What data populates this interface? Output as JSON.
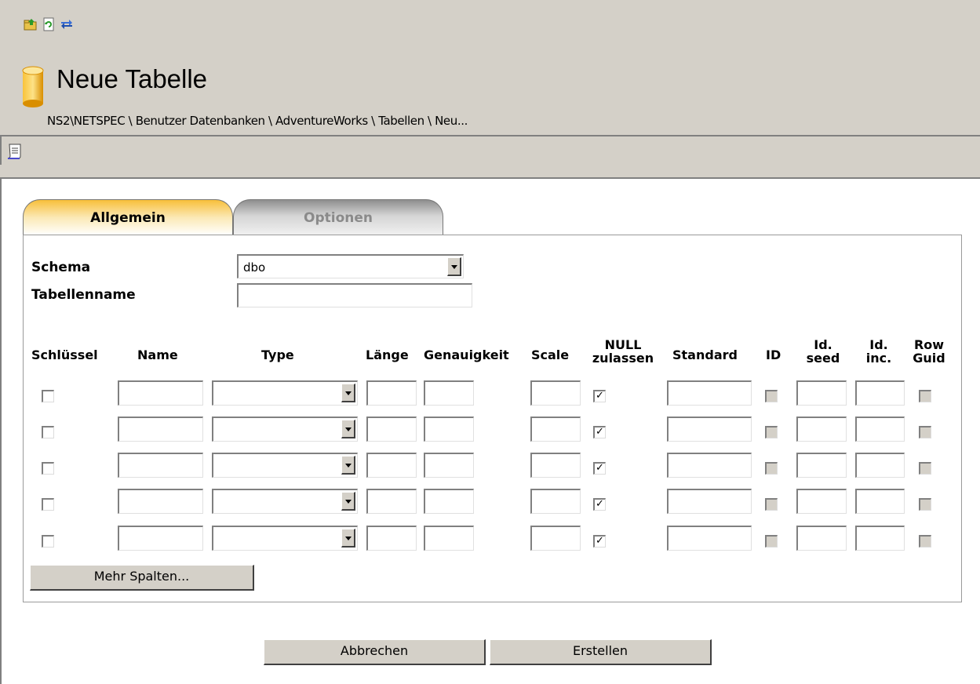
{
  "title": "Neue Tabelle",
  "breadcrumb": "NS2\\NETSPEC \\ Benutzer Datenbanken \\ AdventureWorks \\ Tabellen \\ Neu...",
  "toolbar_icons": [
    "folder-up-icon",
    "refresh-icon",
    "sync-icon"
  ],
  "action_icons": [
    "script-icon"
  ],
  "tabs": [
    {
      "label": "Allgemein",
      "active": true
    },
    {
      "label": "Optionen",
      "active": false
    }
  ],
  "form": {
    "schema_label": "Schema",
    "schema_value": "dbo",
    "tablename_label": "Tabellenname",
    "tablename_value": ""
  },
  "columns_header": {
    "key": "Schlüssel",
    "name": "Name",
    "type": "Type",
    "length": "Länge",
    "precision": "Genauigkeit",
    "scale": "Scale",
    "nullable_1": "NULL",
    "nullable_2": "zulassen",
    "default": "Standard",
    "id": "ID",
    "seed_1": "Id.",
    "seed_2": "seed",
    "inc_1": "Id.",
    "inc_2": "inc.",
    "rowguid_1": "Row",
    "rowguid_2": "Guid"
  },
  "rows": [
    {
      "key": false,
      "name": "",
      "type": "",
      "length": "",
      "precision": "",
      "scale": "",
      "nullable": true,
      "default": "",
      "id": false,
      "seed": "",
      "inc": "",
      "rowguid": false
    },
    {
      "key": false,
      "name": "",
      "type": "",
      "length": "",
      "precision": "",
      "scale": "",
      "nullable": true,
      "default": "",
      "id": false,
      "seed": "",
      "inc": "",
      "rowguid": false
    },
    {
      "key": false,
      "name": "",
      "type": "",
      "length": "",
      "precision": "",
      "scale": "",
      "nullable": true,
      "default": "",
      "id": false,
      "seed": "",
      "inc": "",
      "rowguid": false
    },
    {
      "key": false,
      "name": "",
      "type": "",
      "length": "",
      "precision": "",
      "scale": "",
      "nullable": true,
      "default": "",
      "id": false,
      "seed": "",
      "inc": "",
      "rowguid": false
    },
    {
      "key": false,
      "name": "",
      "type": "",
      "length": "",
      "precision": "",
      "scale": "",
      "nullable": true,
      "default": "",
      "id": false,
      "seed": "",
      "inc": "",
      "rowguid": false
    }
  ],
  "buttons": {
    "more_columns": "Mehr Spalten...",
    "cancel": "Abbrechen",
    "create": "Erstellen"
  },
  "colors": {
    "window_bg": "#d4d0c8",
    "tab_active": "#f8bf3a",
    "db_icon": "#f5a800"
  }
}
